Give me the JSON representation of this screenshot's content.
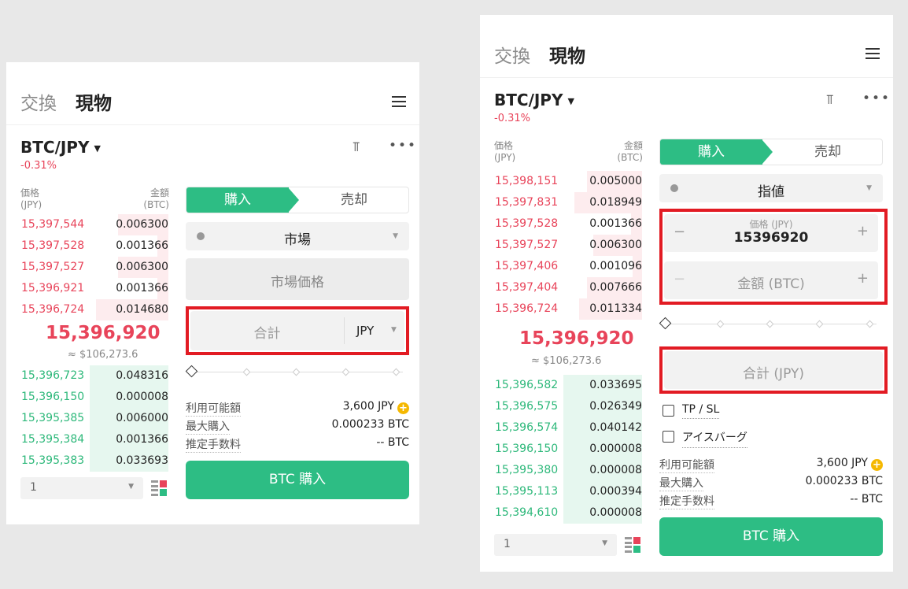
{
  "tabs": {
    "exchange": "交換",
    "spot": "現物"
  },
  "pair": "BTC/JPY",
  "change": "-0.31%",
  "orderbook_header": {
    "price_label": "価格",
    "price_unit": "(JPY)",
    "amount_label": "金額",
    "amount_unit": "(BTC)"
  },
  "mid_price": "15,396,920",
  "usd_approx": "≈ $106,273.6",
  "left": {
    "asks": [
      {
        "price": "15,397,544",
        "amount": "0.006300"
      },
      {
        "price": "15,397,528",
        "amount": "0.001366"
      },
      {
        "price": "15,397,527",
        "amount": "0.006300"
      },
      {
        "price": "15,396,921",
        "amount": "0.001366"
      },
      {
        "price": "15,396,724",
        "amount": "0.014680"
      }
    ],
    "bids": [
      {
        "price": "15,396,723",
        "amount": "0.048316"
      },
      {
        "price": "15,396,150",
        "amount": "0.000008"
      },
      {
        "price": "15,395,385",
        "amount": "0.006000"
      },
      {
        "price": "15,395,384",
        "amount": "0.001366"
      },
      {
        "price": "15,395,383",
        "amount": "0.033693"
      }
    ],
    "buy_tab": "購入",
    "sell_tab": "売却",
    "order_type": "市場",
    "market_price_label": "市場価格",
    "total_placeholder": "合計",
    "currency_select": "JPY",
    "available_label": "利用可能額",
    "available_value": "3,600 JPY",
    "max_buy_label": "最大購入",
    "max_buy_value": "0.000233 BTC",
    "fee_label": "推定手数料",
    "fee_value": "-- BTC",
    "buy_button": "BTC 購入",
    "depth_select": "1"
  },
  "right": {
    "asks": [
      {
        "price": "15,398,151",
        "amount": "0.005000"
      },
      {
        "price": "15,397,831",
        "amount": "0.018949"
      },
      {
        "price": "15,397,528",
        "amount": "0.001366"
      },
      {
        "price": "15,397,527",
        "amount": "0.006300"
      },
      {
        "price": "15,397,406",
        "amount": "0.001096"
      },
      {
        "price": "15,397,404",
        "amount": "0.007666"
      },
      {
        "price": "15,396,724",
        "amount": "0.011334"
      }
    ],
    "bids": [
      {
        "price": "15,396,582",
        "amount": "0.033695"
      },
      {
        "price": "15,396,575",
        "amount": "0.026349"
      },
      {
        "price": "15,396,574",
        "amount": "0.040142"
      },
      {
        "price": "15,396,150",
        "amount": "0.000008"
      },
      {
        "price": "15,395,380",
        "amount": "0.000008"
      },
      {
        "price": "15,395,113",
        "amount": "0.000394"
      },
      {
        "price": "15,394,610",
        "amount": "0.000008"
      }
    ],
    "buy_tab": "購入",
    "sell_tab": "売却",
    "order_type": "指値",
    "price_field_label": "価格 (JPY)",
    "price_field_value": "15396920",
    "amount_placeholder": "金額 (BTC)",
    "total_placeholder": "合計 (JPY)",
    "tpsl_label": "TP / SL",
    "iceberg_label": "アイスバーグ",
    "available_label": "利用可能額",
    "available_value": "3,600 JPY",
    "max_buy_label": "最大購入",
    "max_buy_value": "0.000233 BTC",
    "fee_label": "推定手数料",
    "fee_value": "-- BTC",
    "buy_button": "BTC 購入",
    "depth_select": "1"
  },
  "icons": [
    "menu-icon",
    "candlestick-icon",
    "more-icon",
    "info-icon",
    "chevron-down-icon",
    "minus-icon",
    "plus-icon",
    "coin-add-icon",
    "orderbook-view-icon"
  ],
  "colors": {
    "buy": "#2dbd84",
    "ask": "#e8445a",
    "bid": "#2db87a",
    "highlight": "#e21b23"
  }
}
